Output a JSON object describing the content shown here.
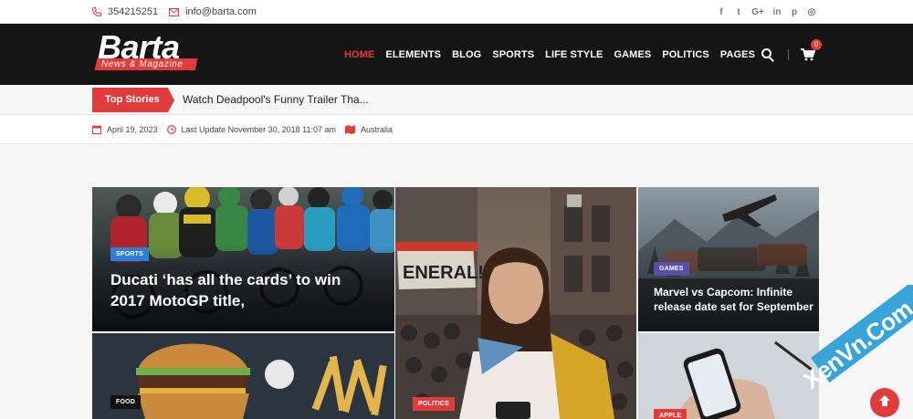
{
  "topbar": {
    "phone": "354215251",
    "email": "info@barta.com",
    "social": [
      "facebook-icon",
      "twitter-icon",
      "google-plus-icon",
      "linkedin-icon",
      "pinterest-icon",
      "instagram-icon"
    ],
    "social_glyphs": [
      "f",
      "t",
      "G+",
      "in",
      "p",
      "◎"
    ]
  },
  "logo": {
    "name": "Barta",
    "tagline": "News & Magazine"
  },
  "nav": {
    "items": [
      {
        "label": "HOME",
        "active": true
      },
      {
        "label": "ELEMENTS",
        "active": false
      },
      {
        "label": "BLOG",
        "active": false
      },
      {
        "label": "SPORTS",
        "active": false
      },
      {
        "label": "LIFE STYLE",
        "active": false
      },
      {
        "label": "GAMES",
        "active": false
      },
      {
        "label": "POLITICS",
        "active": false
      },
      {
        "label": "PAGES",
        "active": false
      }
    ],
    "cart_count": "0"
  },
  "ticker": {
    "label": "Top Stories",
    "headline": "Watch Deadpool's Funny Trailer Tha..."
  },
  "meta": {
    "date": "April 19, 2023",
    "last_update": "Last Update November 30, 2018 11:07 am",
    "location": "Australia"
  },
  "cards": [
    {
      "category": "SPORTS",
      "title": "Ducati ‘has all the cards’ to win 2017 MotoGP title,"
    },
    {
      "category": "POLITICS",
      "title": ""
    },
    {
      "category": "GAMES",
      "title": "Marvel vs Capcom: Infinite release date set for September"
    },
    {
      "category": "FOOD",
      "title": ""
    },
    {
      "category": "APPLE",
      "title": ""
    }
  ],
  "watermark": "XenVn.Com",
  "colors": {
    "accent": "#e23b3b",
    "header_bg": "#151515",
    "sports_badge": "#2d7fd6",
    "games_badge": "#5b4ea8",
    "politics_badge": "#e23b3b",
    "food_badge": "#111111",
    "apple_badge": "#e23b3b"
  }
}
